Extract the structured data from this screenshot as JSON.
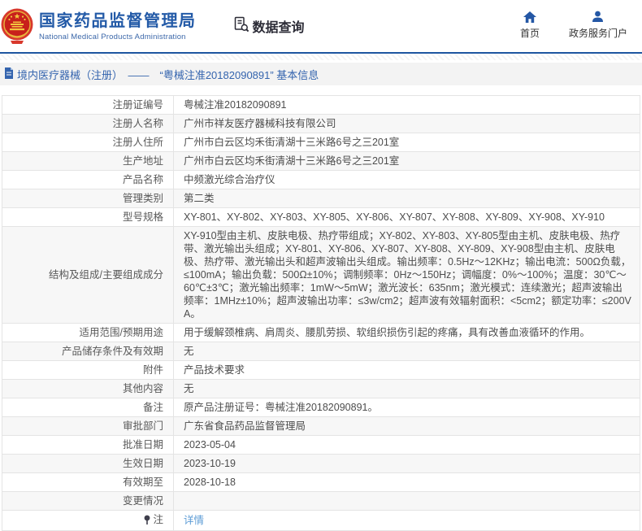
{
  "header": {
    "org_name_zh": "国家药品监督管理局",
    "org_name_en": "National Medical Products Administration",
    "data_query_label": "数据查询",
    "nav": [
      {
        "label": "首页",
        "icon": "home-icon"
      },
      {
        "label": "政务服务门户",
        "icon": "user-icon"
      }
    ],
    "accent_color": "#1e56a0"
  },
  "breadcrumb": {
    "text": "境内医疗器械（注册）　——　“粤械注准20182090891” 基本信息"
  },
  "table": {
    "rows": [
      {
        "label": "注册证编号",
        "value": "粤械注准20182090891"
      },
      {
        "label": "注册人名称",
        "value": "广州市祥友医疗器械科技有限公司"
      },
      {
        "label": "注册人住所",
        "value": "广州市白云区均禾街清湖十三米路6号之三201室"
      },
      {
        "label": "生产地址",
        "value": "广州市白云区均禾街清湖十三米路6号之三201室"
      },
      {
        "label": "产品名称",
        "value": "中频激光综合治疗仪"
      },
      {
        "label": "管理类别",
        "value": "第二类"
      },
      {
        "label": "型号规格",
        "value": "XY-801、XY-802、XY-803、XY-805、XY-806、XY-807、XY-808、XY-809、XY-908、XY-910"
      },
      {
        "label": "结构及组成/主要组成成分",
        "value": "XY-910型由主机、皮肤电极、热疗带组成；XY-802、XY-803、XY-805型由主机、皮肤电极、热疗带、激光输出头组成；XY-801、XY-806、XY-807、XY-808、XY-809、XY-908型由主机、皮肤电极、热疗带、激光输出头和超声波输出头组成。输出频率：0.5Hz～12KHz；输出电流：500Ω负载，≤100mA；输出负载：500Ω±10%；调制频率：0Hz～150Hz；调幅度：0%～100%；温度：30℃～60℃±3℃；激光输出频率：1mW～5mW；激光波长：635nm；激光模式：连续激光；超声波输出频率：1MHz±10%；超声波输出功率：≤3w/cm2；超声波有效辐射面积：<5cm2；额定功率：≤200VA。"
      },
      {
        "label": "适用范围/预期用途",
        "value": "用于缓解颈椎病、肩周炎、腰肌劳损、软组织损伤引起的疼痛，具有改善血液循环的作用。"
      },
      {
        "label": "产品储存条件及有效期",
        "value": "无"
      },
      {
        "label": "附件",
        "value": "产品技术要求"
      },
      {
        "label": "其他内容",
        "value": "无"
      },
      {
        "label": "备注",
        "value": "原产品注册证号：粤械注准20182090891。"
      },
      {
        "label": "审批部门",
        "value": "广东省食品药品监督管理局"
      },
      {
        "label": "批准日期",
        "value": "2023-05-04"
      },
      {
        "label": "生效日期",
        "value": "2023-10-19"
      },
      {
        "label": "有效期至",
        "value": "2028-10-18"
      },
      {
        "label": "变更情况",
        "value": ""
      },
      {
        "label": "注",
        "value": "详情",
        "link": true,
        "label_icon": "note-icon"
      }
    ]
  }
}
